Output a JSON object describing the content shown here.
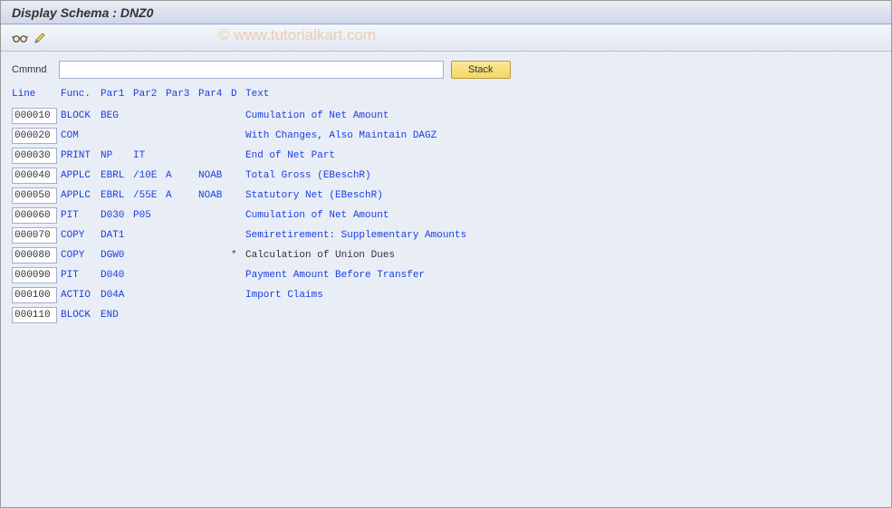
{
  "title": "Display Schema : DNZ0",
  "watermark": "© www.tutorialkart.com",
  "command": {
    "label": "Cmmnd",
    "value": "",
    "stack_label": "Stack"
  },
  "headers": {
    "line": "Line",
    "func": "Func.",
    "par1": "Par1",
    "par2": "Par2",
    "par3": "Par3",
    "par4": "Par4",
    "d": "D",
    "text": "Text"
  },
  "rows": [
    {
      "line": "000010",
      "func": "BLOCK",
      "par1": "BEG",
      "par2": "",
      "par3": "",
      "par4": "",
      "d": "",
      "text": "Cumulation of Net Amount",
      "text_black": false
    },
    {
      "line": "000020",
      "func": "COM",
      "par1": "",
      "par2": "",
      "par3": "",
      "par4": "",
      "d": "",
      "text": "With Changes, Also Maintain DAGZ",
      "text_black": false
    },
    {
      "line": "000030",
      "func": "PRINT",
      "par1": "NP",
      "par2": "IT",
      "par3": "",
      "par4": "",
      "d": "",
      "text": "End of Net Part",
      "text_black": false
    },
    {
      "line": "000040",
      "func": "APPLC",
      "par1": "EBRL",
      "par2": "/10E",
      "par3": "A",
      "par4": "NOAB",
      "d": "",
      "text": "Total Gross (EBeschR)",
      "text_black": false
    },
    {
      "line": "000050",
      "func": "APPLC",
      "par1": "EBRL",
      "par2": "/55E",
      "par3": "A",
      "par4": "NOAB",
      "d": "",
      "text": "Statutory Net (EBeschR)",
      "text_black": false
    },
    {
      "line": "000060",
      "func": "PIT",
      "par1": "D030",
      "par2": "P05",
      "par3": "",
      "par4": "",
      "d": "",
      "text": "Cumulation of Net Amount",
      "text_black": false
    },
    {
      "line": "000070",
      "func": "COPY",
      "par1": "DAT1",
      "par2": "",
      "par3": "",
      "par4": "",
      "d": "",
      "text": "Semiretirement: Supplementary Amounts",
      "text_black": false
    },
    {
      "line": "000080",
      "func": "COPY",
      "par1": "DGW0",
      "par2": "",
      "par3": "",
      "par4": "",
      "d": "*",
      "text": "Calculation of Union Dues",
      "text_black": true
    },
    {
      "line": "000090",
      "func": "PIT",
      "par1": "D040",
      "par2": "",
      "par3": "",
      "par4": "",
      "d": "",
      "text": "Payment Amount Before Transfer",
      "text_black": false
    },
    {
      "line": "000100",
      "func": "ACTIO",
      "par1": "D04A",
      "par2": "",
      "par3": "",
      "par4": "",
      "d": "",
      "text": "Import Claims",
      "text_black": false
    },
    {
      "line": "000110",
      "func": "BLOCK",
      "par1": "END",
      "par2": "",
      "par3": "",
      "par4": "",
      "d": "",
      "text": "",
      "text_black": false
    }
  ]
}
